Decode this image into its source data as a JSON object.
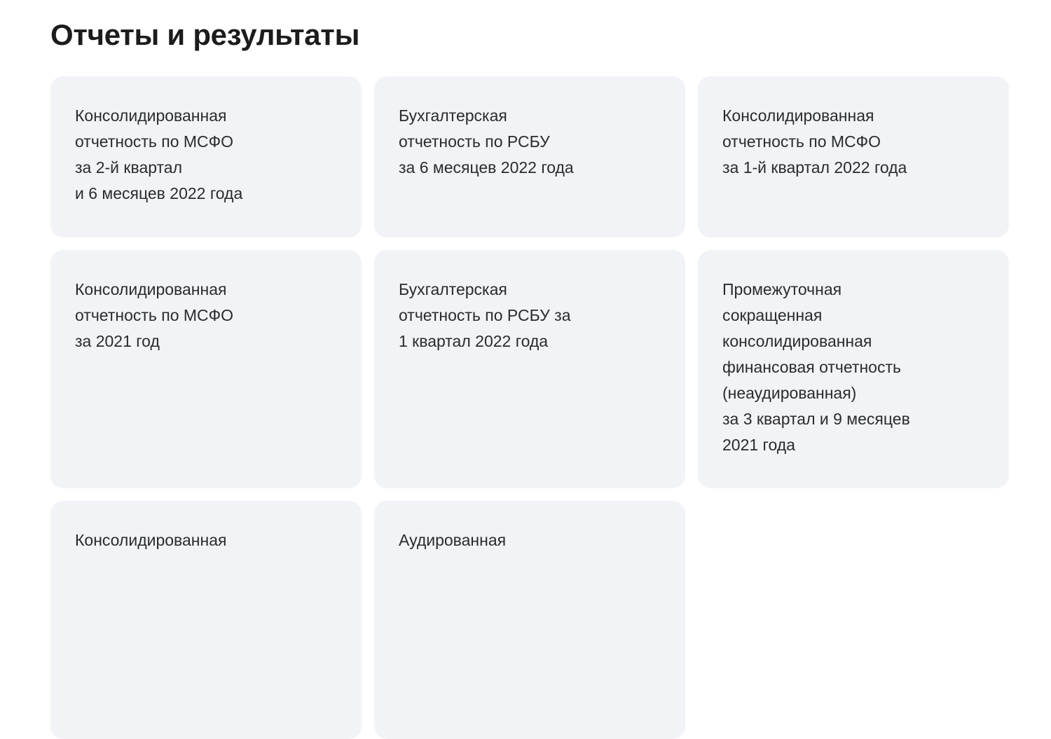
{
  "page": {
    "title": "Отчеты и результаты"
  },
  "cards": [
    {
      "text": "Консолидированная\nотчетность по МСФО\nза 2-й квартал\nи 6 месяцев 2022 года"
    },
    {
      "text": "Бухгалтерская\nотчетность по РСБУ\nза 6 месяцев 2022 года"
    },
    {
      "text": "Консолидированная\nотчетность по МСФО\nза 1-й квартал 2022 года"
    },
    {
      "text": "Консолидированная\nотчетность по МСФО\nза 2021 год"
    },
    {
      "text": "Бухгалтерская\nотчетность по РСБУ за\n1 квартал 2022 года"
    },
    {
      "text": "Промежуточная\nсокращенная\nконсолидированная\nфинансовая отчетность\n(неаудированная)\nза 3 квартал и 9 месяцев\n2021 года"
    },
    {
      "text": "Консолидированная"
    },
    {
      "text": "Аудированная"
    }
  ],
  "colors": {
    "card_background": "#f1f3f6",
    "text": "#2b2b2b",
    "title": "#1c1c1c"
  }
}
